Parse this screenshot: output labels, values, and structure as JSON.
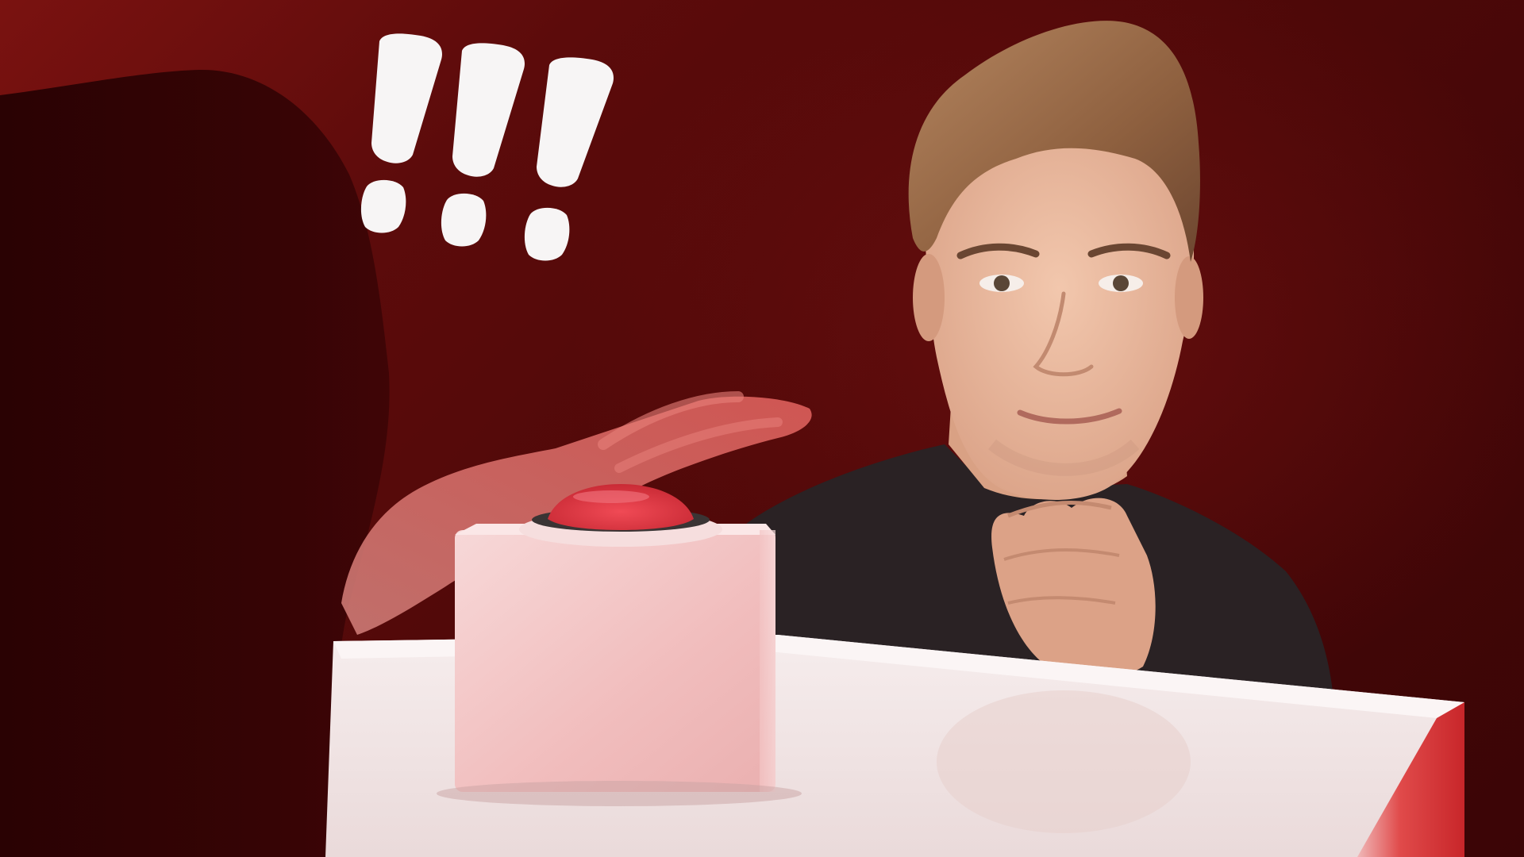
{
  "scene": {
    "exclamation_text": "!!!",
    "background_color": "#4d0808",
    "button_cap_color": "#e23a45",
    "box_color": "#f2caca",
    "table_color": "#f3e8e8",
    "shirt_color": "#2a2224",
    "skin_color": "#e8b79a",
    "hair_color": "#9a6a48"
  }
}
